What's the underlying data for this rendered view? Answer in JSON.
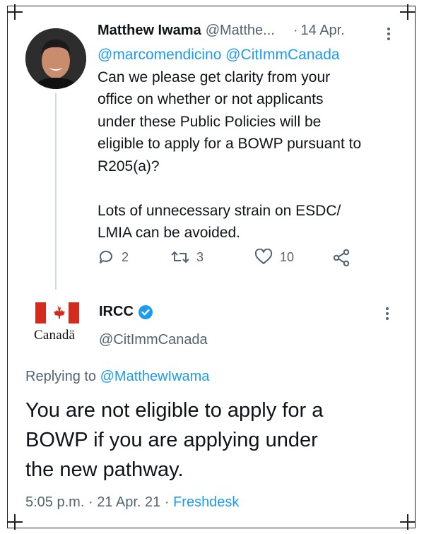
{
  "tweet1": {
    "author_name": "Matthew Iwama",
    "author_handle": "@Matthe...",
    "date_separator": "·",
    "date": "14 Apr.",
    "mentions": "@marcomendicino @CitImmCanada",
    "body_lines": [
      "Can we please get clarity from your",
      "office on whether or not applicants",
      "under these Public Policies will be",
      "eligible to apply for a BOWP pursuant to",
      "R205(a)?"
    ],
    "body_lines_2": [
      "Lots of unnecessary strain on ESDC/",
      "LMIA can be avoided."
    ],
    "actions": {
      "reply_count": "2",
      "retweet_count": "3",
      "like_count": "10"
    }
  },
  "tweet2": {
    "logo_wordmark": "Canadä",
    "author_name": "IRCC",
    "author_handle": "@CitImmCanada",
    "replying_to_prefix": "Replying to",
    "replying_to_handle": "@MatthewIwama",
    "body_lines": [
      "You are not eligible to apply for a",
      "BOWP if you are applying under",
      "the new pathway."
    ],
    "time": "5:05 p.m.",
    "date": "21 Apr. 21",
    "source": "Freshdesk",
    "meta_separator": "·"
  },
  "colors": {
    "link": "#1d9bf0",
    "secondary_text": "#536471",
    "flag_red": "#d52b1e"
  },
  "icons": [
    "more-icon",
    "reply-icon",
    "retweet-icon",
    "like-icon",
    "share-icon",
    "verified-badge-icon",
    "canada-flag-icon"
  ]
}
